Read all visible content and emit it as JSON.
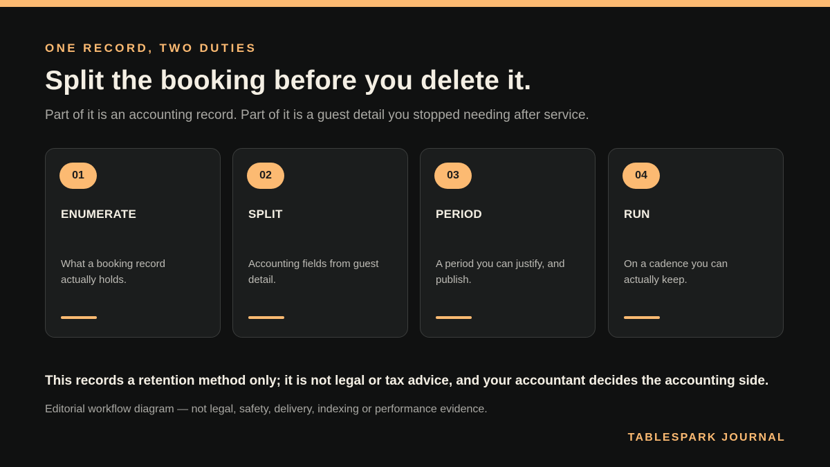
{
  "colors": {
    "background": "#101111",
    "accent": "#fcba72",
    "card_background": "#1b1d1d",
    "card_border": "#3b3d3c",
    "heading_text": "#f4efe4",
    "muted_text": "#a9a8a3"
  },
  "header": {
    "eyebrow": "ONE RECORD, TWO DUTIES",
    "title": "Split the booking before you delete it.",
    "subtitle": "Part of it is an accounting record. Part of it is a guest detail you stopped needing after service."
  },
  "steps": [
    {
      "number": "01",
      "title": "ENUMERATE",
      "description": "What a booking record actually holds."
    },
    {
      "number": "02",
      "title": "SPLIT",
      "description": "Accounting fields from guest detail."
    },
    {
      "number": "03",
      "title": "PERIOD",
      "description": "A period you can justify, and publish."
    },
    {
      "number": "04",
      "title": "RUN",
      "description": "On a cadence you can actually keep."
    }
  ],
  "footer": {
    "note": "This records a retention method only; it is not legal or tax advice, and your accountant decides the accounting side.",
    "caption": "Editorial workflow diagram — not legal, safety, delivery, indexing or performance evidence.",
    "brand": "TABLESPARK JOURNAL"
  }
}
